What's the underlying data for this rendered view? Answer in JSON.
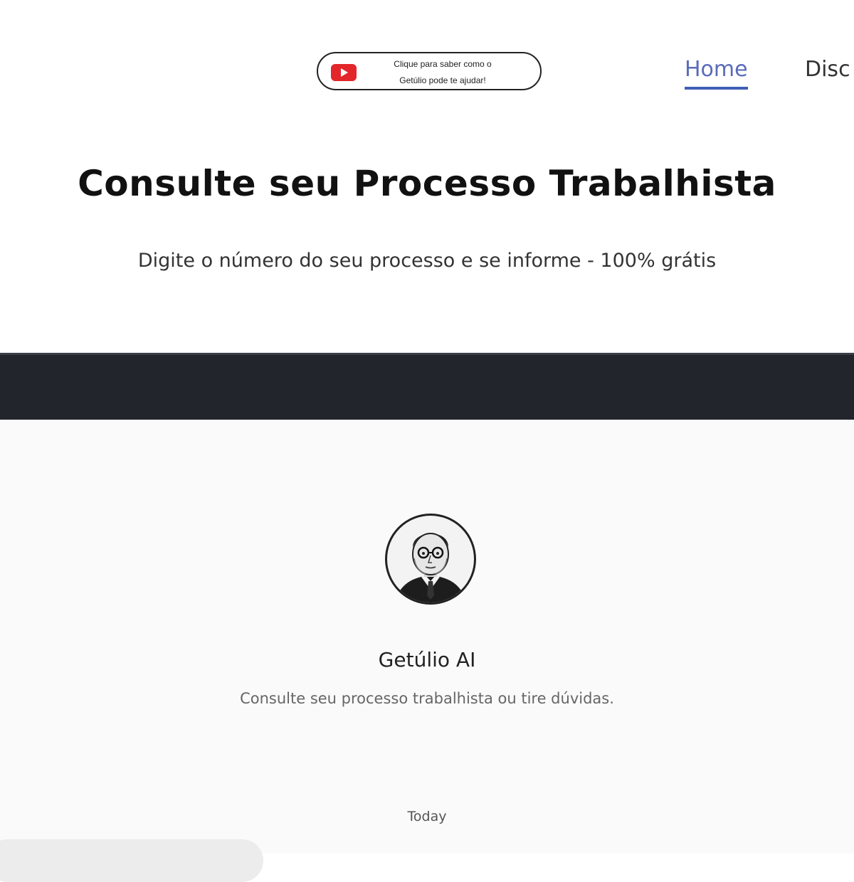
{
  "header": {
    "video_pill": {
      "icon": "youtube-play-icon",
      "line1": "Clique para saber como o",
      "line2": "Getúlio pode te ajudar!"
    },
    "nav": {
      "home": "Home",
      "second": "Disc"
    },
    "active_nav_color": "#3f5fb5"
  },
  "hero": {
    "title": "Consulte seu Processo Trabalhista",
    "subtitle": "Digite o número do seu processo e se informe - 100% grátis"
  },
  "chat": {
    "bot_name": "Getúlio AI",
    "bot_description": "Consulte seu processo trabalhista ou tire dúvidas.",
    "date_separator": "Today",
    "avatar": "portrait-avatar"
  },
  "colors": {
    "band": "#22252c",
    "chat_background": "#fafafa",
    "youtube_red": "#e3262b"
  }
}
